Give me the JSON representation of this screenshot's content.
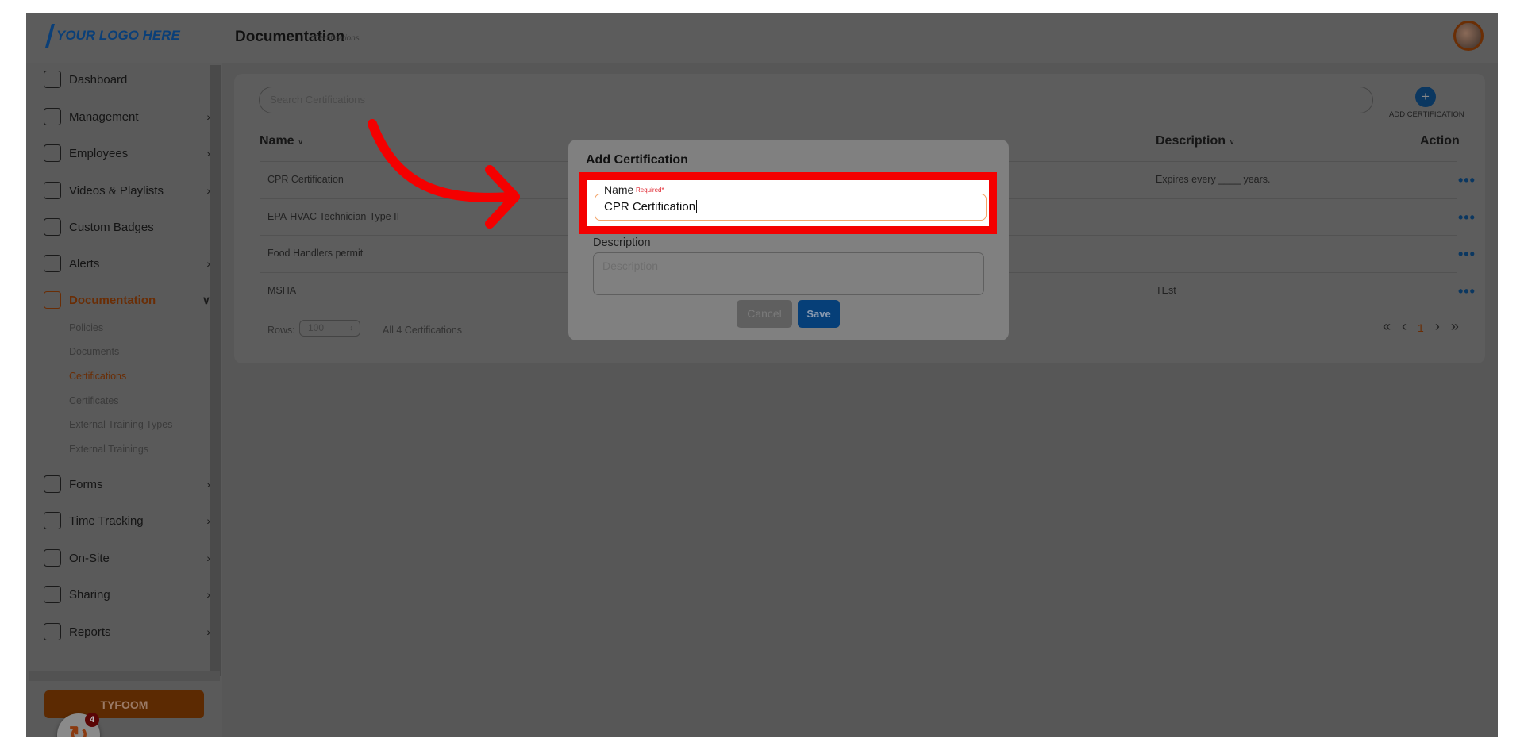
{
  "header": {
    "logo": "YOUR LOGO HERE",
    "title": "Documentation",
    "subtitle": "Certifications"
  },
  "sidebar": {
    "items": [
      {
        "label": "Dashboard",
        "icon": "dashboard-icon",
        "chevron": false
      },
      {
        "label": "Management",
        "icon": "users-icon",
        "chevron": true
      },
      {
        "label": "Employees",
        "icon": "user-icon",
        "chevron": true
      },
      {
        "label": "Videos & Playlists",
        "icon": "play-icon",
        "chevron": true
      },
      {
        "label": "Custom Badges",
        "icon": "badge-icon",
        "chevron": false
      },
      {
        "label": "Alerts",
        "icon": "chat-icon",
        "chevron": true
      },
      {
        "label": "Documentation",
        "icon": "document-icon",
        "chevron": true,
        "active": true
      },
      {
        "label": "Forms",
        "icon": "list-icon",
        "chevron": true
      },
      {
        "label": "Time Tracking",
        "icon": "stopwatch-icon",
        "chevron": true
      },
      {
        "label": "On-Site",
        "icon": "location-pin-icon",
        "chevron": true
      },
      {
        "label": "Sharing",
        "icon": "share-user-icon",
        "chevron": true
      },
      {
        "label": "Reports",
        "icon": "bar-chart-icon",
        "chevron": true
      }
    ],
    "subitems": [
      "Policies",
      "Documents",
      "Certifications",
      "Certificates",
      "External Training Types",
      "External Trainings"
    ],
    "active_subitem": "Certifications",
    "brand_button": "TYFOOM",
    "notification_count": "4"
  },
  "main": {
    "search_placeholder": "Search Certifications",
    "add_label": "ADD CERTIFICATION",
    "columns": {
      "name": "Name",
      "description": "Description",
      "action": "Action"
    },
    "rows": [
      {
        "name": "CPR Certification",
        "description": "Expires every ____ years."
      },
      {
        "name": "EPA-HVAC Technician-Type II",
        "description": ""
      },
      {
        "name": "Food Handlers permit",
        "description": ""
      },
      {
        "name": "MSHA",
        "description": "TEst"
      }
    ],
    "rows_label": "Rows:",
    "rows_value": "100",
    "total": "All 4 Certifications",
    "page": "1"
  },
  "modal": {
    "title": "Add Certification",
    "name_label": "Name",
    "required": "Required*",
    "name_value": "CPR Certification",
    "description_label": "Description",
    "description_placeholder": "Description",
    "cancel": "Cancel",
    "save": "Save"
  },
  "colors": {
    "accent": "#d4580a",
    "primary": "#0a5fb4",
    "highlight": "#ff0000"
  }
}
